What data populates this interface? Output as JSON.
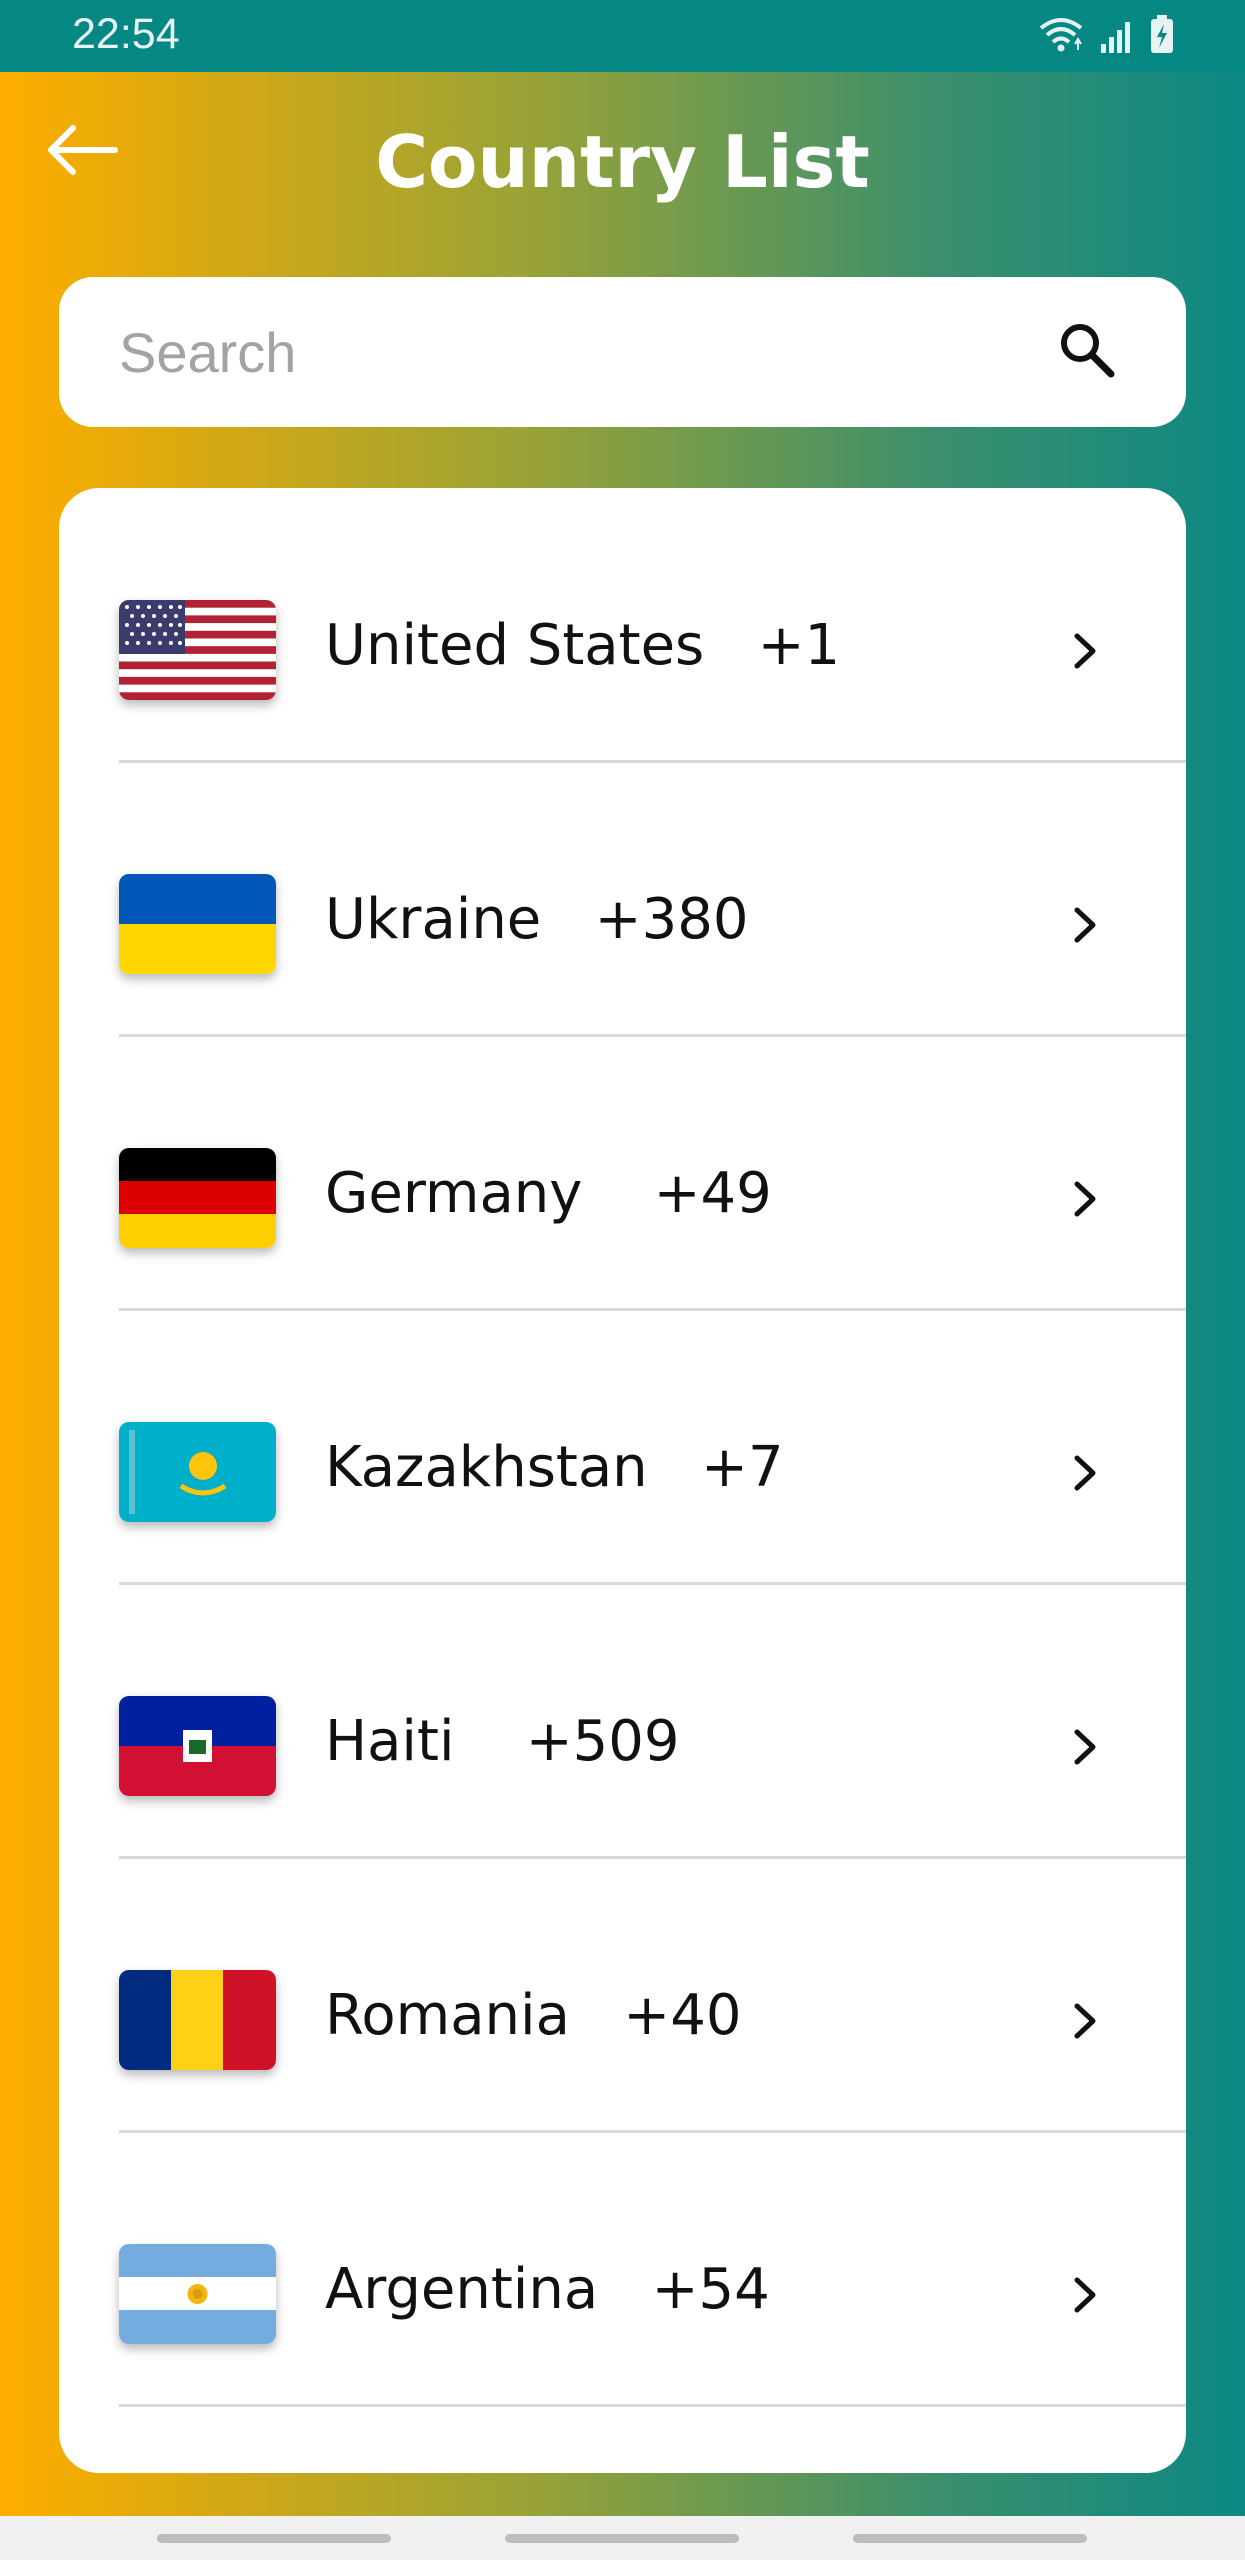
{
  "status_bar": {
    "time": "22:54",
    "icons": [
      "wifi-icon",
      "signal-icon",
      "battery-charging-icon"
    ]
  },
  "header": {
    "title": "Country List",
    "back_icon": "arrow-left-icon"
  },
  "search": {
    "placeholder": "Search",
    "value": "",
    "icon": "search-icon"
  },
  "countries": [
    {
      "name": "United States",
      "code": "+1",
      "flag": "us-flag-icon"
    },
    {
      "name": "Ukraine",
      "code": "+380",
      "flag": "ukraine-flag-icon"
    },
    {
      "name": "Germany",
      "code": "+49",
      "flag": "germany-flag-icon"
    },
    {
      "name": "Kazakhstan",
      "code": "+7",
      "flag": "kazakhstan-flag-icon"
    },
    {
      "name": "Haiti",
      "code": "+509",
      "flag": "haiti-flag-icon"
    },
    {
      "name": "Romania",
      "code": "+40",
      "flag": "romania-flag-icon"
    },
    {
      "name": "Argentina",
      "code": "+54",
      "flag": "argentina-flag-icon"
    }
  ],
  "colors": {
    "gradient_start": "#ffae00",
    "gradient_end": "#0c8883",
    "status_bar": "#058784",
    "card": "#ffffff"
  }
}
